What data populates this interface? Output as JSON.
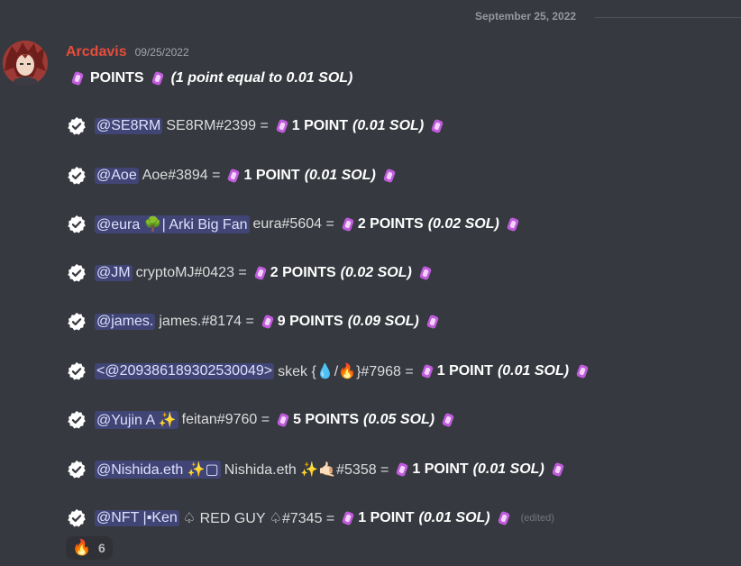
{
  "divider": {
    "date": "September 25, 2022"
  },
  "message": {
    "username": "Arcdavis",
    "timestamp": "09/25/2022",
    "title_label": "POINTS",
    "title_rate": "(1 point equal to 0.01 SOL)",
    "entries": [
      {
        "mention": "@SE8RM",
        "tag": "SE8RM#2399 =",
        "points": "1 POINT",
        "sol": "(0.01 SOL)"
      },
      {
        "mention": "@Aoe",
        "tag": "Aoe#3894 =",
        "points": "1 POINT",
        "sol": "(0.01 SOL)"
      },
      {
        "mention": "@eura 🌳| Arki Big Fan",
        "tag": "eura#5604  =",
        "points": "2 POINTS",
        "sol": "(0.02 SOL)"
      },
      {
        "mention": "@JM",
        "tag": "cryptoMJ#0423 =",
        "points": "2 POINTS",
        "sol": "(0.02 SOL)"
      },
      {
        "mention": "@james.",
        "tag": "james.#8174  =",
        "points": "9 POINTS",
        "sol": "(0.09 SOL)"
      },
      {
        "mention": "<@209386189302530049>",
        "tag": "skek {💧/🔥}#7968 =",
        "points": "1 POINT",
        "sol": "(0.01 SOL)"
      },
      {
        "mention": "@Yujin A ✨",
        "tag": "feitan#9760 =",
        "points": "5 POINTS",
        "sol": "(0.05 SOL)"
      },
      {
        "mention": "@Nishida.eth ✨▢",
        "tag": "Nishida.eth ✨🤙🏻#5358 =",
        "points": "1 POINT",
        "sol": "(0.01 SOL)"
      },
      {
        "mention": "@NFT |▪Ken",
        "tag": "♤ RED GUY ♤#7345 =",
        "points": "1 POINT",
        "sol": "(0.01 SOL)",
        "edited": "(edited)"
      }
    ],
    "reaction": {
      "emoji": "🔥",
      "count": "6"
    }
  },
  "colors": {
    "background": "#36393f",
    "username": "#e74c3c",
    "mention_bg": "#4a4f8a",
    "gem": "#c05bdc"
  }
}
